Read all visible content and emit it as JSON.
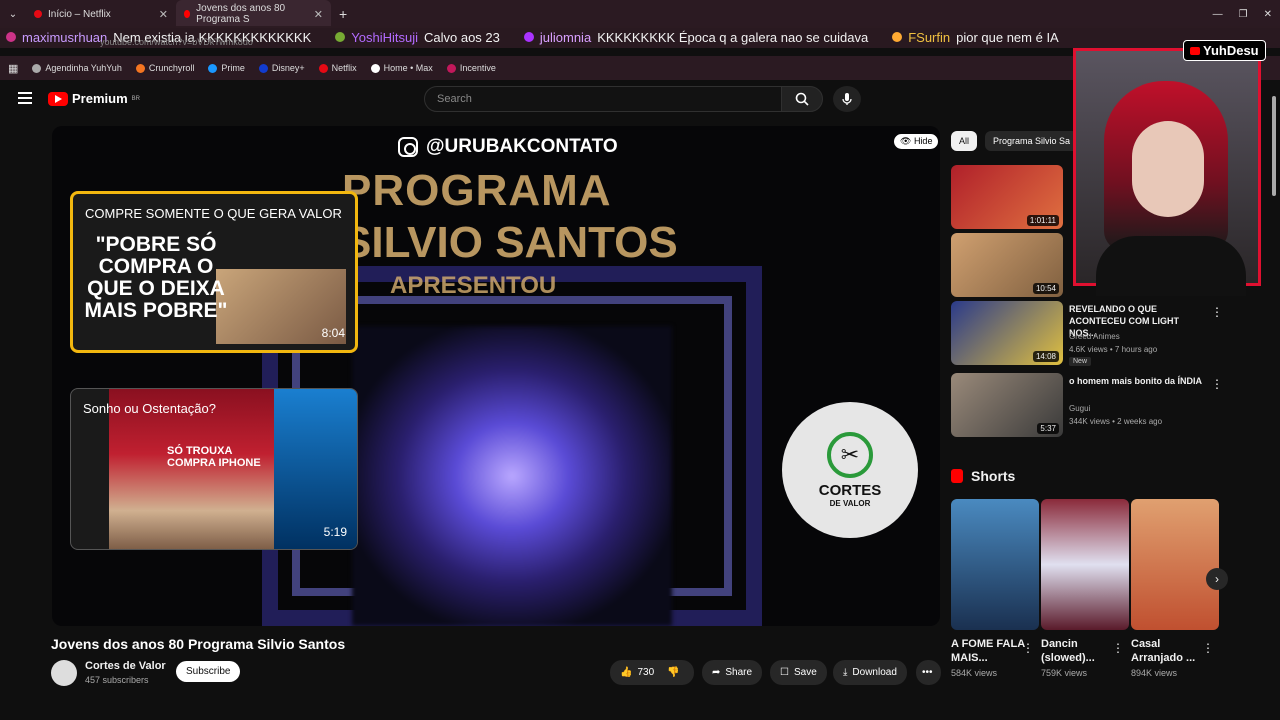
{
  "browser": {
    "tabs": [
      {
        "label": "Início – Netflix"
      },
      {
        "label": "Jovens dos anos 80 Programa S"
      }
    ],
    "address": "youtube.com/watch?v=bVDkTwmk8do",
    "bookmarks": [
      {
        "label": "Agendinha YuhYuh",
        "color": "#aaaaaa"
      },
      {
        "label": "Crunchyroll",
        "color": "#f47521"
      },
      {
        "label": "Prime",
        "color": "#1a98ff"
      },
      {
        "label": "Disney+",
        "color": "#113ccf"
      },
      {
        "label": "Netflix",
        "color": "#e50914"
      },
      {
        "label": "Home • Max",
        "color": "#ffffff"
      },
      {
        "label": "Incentive",
        "color": "#c2185b"
      }
    ]
  },
  "chat": [
    {
      "user": "maximusrhuan",
      "message": "Nem existia ia KKKKKKKKKKKKK"
    },
    {
      "user": "YoshiHitsuji",
      "message": "Calvo aos 23"
    },
    {
      "user": "juliomnia",
      "message": "KKKKKKKKK Época q a galera nao se cuidava"
    },
    {
      "user": "FSurfin",
      "message": "pior que nem é IA"
    }
  ],
  "youtube": {
    "logo": "Premium",
    "region": "BR",
    "search_placeholder": "Search"
  },
  "player": {
    "watermark": "@URUBAKCONTATO",
    "hide_label": "Hide",
    "overlay_line1": "PROGRAMA",
    "overlay_line2": "SILVIO SANTOS",
    "overlay_line3": "APRESENTOU",
    "end_cards": [
      {
        "title": "COMPRE SOMENTE O QUE GERA VALOR",
        "thumb_text": "\"POBRE SÓ COMPRA O QUE O DEIXA MAIS POBRE\"",
        "duration": "8:04"
      },
      {
        "title": "Sonho ou Ostentação?",
        "thumb_text": "SÓ TROUXA COMPRA IPHONE",
        "duration": "5:19"
      }
    ],
    "channel_logo_text": "CORTES",
    "channel_logo_sub": "DE VALOR"
  },
  "video": {
    "title": "Jovens dos anos 80 Programa Silvio Santos",
    "channel": "Cortes de Valor",
    "subscribers": "457 subscribers",
    "subscribe_label": "Subscribe",
    "likes": "730",
    "share_label": "Share",
    "save_label": "Save",
    "download_label": "Download"
  },
  "sidebar": {
    "chips": [
      {
        "label": "All"
      },
      {
        "label": "Programa Silvio Sa"
      }
    ],
    "related": [
      {
        "title": "",
        "channel": "",
        "meta": "",
        "duration": "1:01:11",
        "color": "#b0202a"
      },
      {
        "title": "",
        "channel": "",
        "meta": "",
        "duration": "10:54",
        "color": "#a07050"
      },
      {
        "title": "REVELANDO O QUE ACONTECEU COM LIGHT NOS...",
        "channel": "Greed Animes",
        "meta": "4.6K views • 7 hours ago",
        "badge": "New",
        "duration": "14:08",
        "color": "#2a3a8a"
      },
      {
        "title": "o homem mais bonito da ÍNDIA",
        "channel": "Gugui",
        "meta": "344K views • 2 weeks ago",
        "duration": "5:37",
        "color": "#6a5a4a"
      }
    ],
    "shorts_label": "Shorts",
    "shorts": [
      {
        "title": "A FOME FALA MAIS...",
        "views": "584K views",
        "color": "#3a7ab0"
      },
      {
        "title": "Dancin (slowed)...",
        "views": "759K views",
        "color": "#7a2a3a"
      },
      {
        "title": "Casal Arranjado ...",
        "views": "894K views",
        "color": "#c88a5a"
      }
    ]
  },
  "webcam": {
    "label": "YuhDesu"
  }
}
